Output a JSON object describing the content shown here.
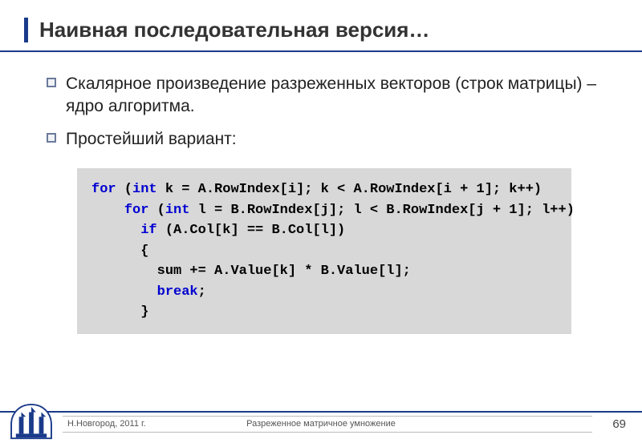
{
  "title": "Наивная последовательная версия…",
  "bullets": [
    "Скалярное произведение разреженных векторов (строк матрицы) – ядро алгоритма.",
    "Простейший вариант:"
  ],
  "code": {
    "line1_for": "for",
    "line1_int": "int",
    "line1_rest": " k = A.RowIndex[i]; k < A.RowIndex[i + 1]; k++)",
    "line2_for": "for",
    "line2_int": "int",
    "line2_rest": " l = B.RowIndex[j]; l < B.RowIndex[j + 1]; l++)",
    "line3_if": "if",
    "line3_rest": " (A.Col[k] == B.Col[l])",
    "line4": "{",
    "line5": "sum += A.Value[k] * B.Value[l];",
    "line6_break": "break",
    "line6_semi": ";",
    "line7": "}"
  },
  "footer": {
    "left": "Н.Новгород, 2011 г.",
    "center": "Разреженное матричное умножение",
    "page": "69"
  }
}
